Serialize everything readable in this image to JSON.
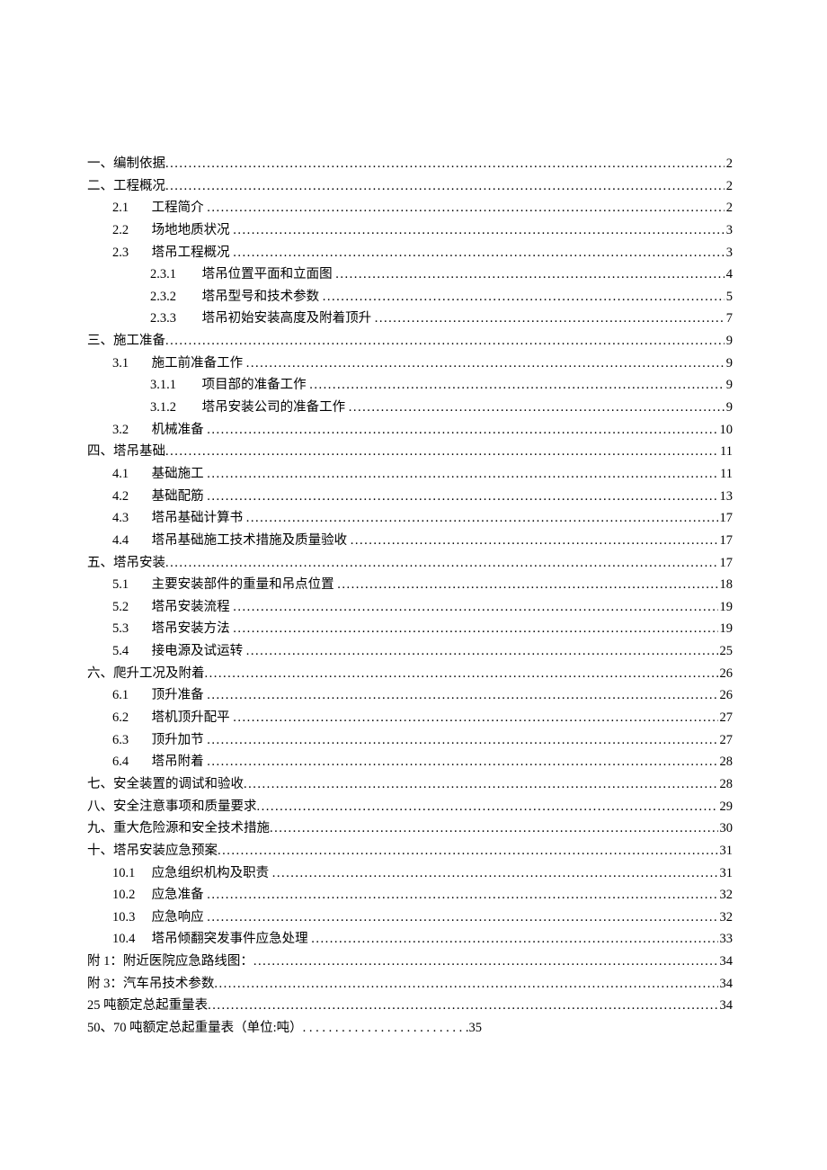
{
  "toc": [
    {
      "level": 0,
      "num": "",
      "title": "一、编制依据",
      "page": "2"
    },
    {
      "level": 0,
      "num": "",
      "title": "二、工程概况",
      "page": "2"
    },
    {
      "level": 1,
      "num": "2.1",
      "title": "工程简介",
      "page": "2"
    },
    {
      "level": 1,
      "num": "2.2",
      "title": "场地地质状况",
      "page": "3"
    },
    {
      "level": 1,
      "num": "2.3",
      "title": "塔吊工程概况",
      "page": "3"
    },
    {
      "level": 2,
      "num": "2.3.1",
      "title": "塔吊位置平面和立面图",
      "page": "4"
    },
    {
      "level": 2,
      "num": "2.3.2",
      "title": "塔吊型号和技术参数",
      "page": "5"
    },
    {
      "level": 2,
      "num": "2.3.3",
      "title": "塔吊初始安装高度及附着顶升",
      "page": "7"
    },
    {
      "level": 0,
      "num": "",
      "title": "三、施工准备",
      "page": "9"
    },
    {
      "level": 1,
      "num": "3.1",
      "title": "施工前准备工作",
      "page": "9"
    },
    {
      "level": 2,
      "num": "3.1.1",
      "title": "项目部的准备工作",
      "page": "9"
    },
    {
      "level": 2,
      "num": "3.1.2",
      "title": "塔吊安装公司的准备工作",
      "page": "9"
    },
    {
      "level": 1,
      "num": "3.2",
      "title": "机械准备",
      "page": "10"
    },
    {
      "level": 0,
      "num": "",
      "title": "四、塔吊基础",
      "page": "11"
    },
    {
      "level": 1,
      "num": "4.1",
      "title": "基础施工",
      "page": "11"
    },
    {
      "level": 1,
      "num": "4.2",
      "title": "基础配筋",
      "page": "13"
    },
    {
      "level": 1,
      "num": "4.3",
      "title": "塔吊基础计算书",
      "page": "17"
    },
    {
      "level": 1,
      "num": "4.4",
      "title": "塔吊基础施工技术措施及质量验收",
      "page": "17"
    },
    {
      "level": 0,
      "num": "",
      "title": "五、塔吊安装",
      "page": "17"
    },
    {
      "level": 1,
      "num": "5.1",
      "title": "主要安装部件的重量和吊点位置",
      "page": "18"
    },
    {
      "level": 1,
      "num": "5.2",
      "title": "塔吊安装流程",
      "page": "19"
    },
    {
      "level": 1,
      "num": "5.3",
      "title": "塔吊安装方法",
      "page": "19"
    },
    {
      "level": 1,
      "num": "5.4",
      "title": "接电源及试运转",
      "page": "25"
    },
    {
      "level": 0,
      "num": "",
      "title": "六、爬升工况及附着",
      "page": "26"
    },
    {
      "level": 1,
      "num": "6.1",
      "title": "顶升准备",
      "page": "26"
    },
    {
      "level": 1,
      "num": "6.2",
      "title": "塔机顶升配平",
      "page": "27"
    },
    {
      "level": 1,
      "num": "6.3",
      "title": "顶升加节",
      "page": "27"
    },
    {
      "level": 1,
      "num": "6.4",
      "title": "塔吊附着",
      "page": "28"
    },
    {
      "level": 0,
      "num": "",
      "title": "七、安全装置的调试和验收",
      "page": "28"
    },
    {
      "level": 0,
      "num": "",
      "title": "八、安全注意事项和质量要求",
      "page": "29"
    },
    {
      "level": 0,
      "num": "",
      "title": "九、重大危险源和安全技术措施",
      "page": "30"
    },
    {
      "level": 0,
      "num": "",
      "title": "十、塔吊安装应急预案",
      "page": "31"
    },
    {
      "level": 1,
      "num": "10.1",
      "title": "应急组织机构及职责",
      "page": "31"
    },
    {
      "level": 1,
      "num": "10.2",
      "title": "应急准备",
      "page": "32"
    },
    {
      "level": 1,
      "num": "10.3",
      "title": "应急响应",
      "page": "32"
    },
    {
      "level": 1,
      "num": "10.4",
      "title": "塔吊倾翻突发事件应急处理",
      "page": "33"
    },
    {
      "level": 0,
      "num": "",
      "title": "附 1：附近医院应急路线图：",
      "page": "34"
    },
    {
      "level": 0,
      "num": "",
      "title": "附 3：汽车吊技术参数",
      "page": "34"
    },
    {
      "level": 0,
      "num": "",
      "title": "25 吨额定总起重量表",
      "page": "34"
    },
    {
      "level": 0,
      "num": "",
      "title": "50、70 吨额定总起重量表（单位:吨）",
      "page": "35",
      "short_leader": true
    }
  ]
}
